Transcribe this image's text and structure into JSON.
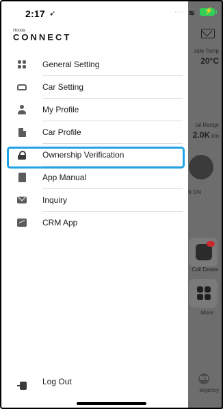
{
  "status_bar": {
    "time": "2:17",
    "location_glyph": "➶",
    "signal": "....",
    "wifi_glyph": "≋",
    "battery_glyph": "⚡"
  },
  "brand": {
    "small": "Honda",
    "name": "CONNECT"
  },
  "menu": {
    "items": [
      {
        "label": "General Setting",
        "icon": "grid-icon"
      },
      {
        "label": "Car Setting",
        "icon": "car-icon"
      },
      {
        "label": "My Profile",
        "icon": "person-icon"
      },
      {
        "label": "Car Profile",
        "icon": "document-icon"
      },
      {
        "label": "Ownership Verification",
        "icon": "lock-icon"
      },
      {
        "label": "App Manual",
        "icon": "book-icon"
      },
      {
        "label": "Inquiry",
        "icon": "mail-icon"
      },
      {
        "label": "CRM App",
        "icon": "chart-icon"
      }
    ],
    "logout_label": "Log Out",
    "highlight_color": "#1ea3e8"
  },
  "background": {
    "inside_temp_label": "side Temp",
    "inside_temp_value": "20°C",
    "total_range_label": "tal Range",
    "total_range_value": "2.0K",
    "range_unit": "km",
    "engine_status": "N ON",
    "call_dealer": "Call Dealer",
    "more": "More",
    "sos_label": "SOS",
    "emergency": "ergency"
  }
}
